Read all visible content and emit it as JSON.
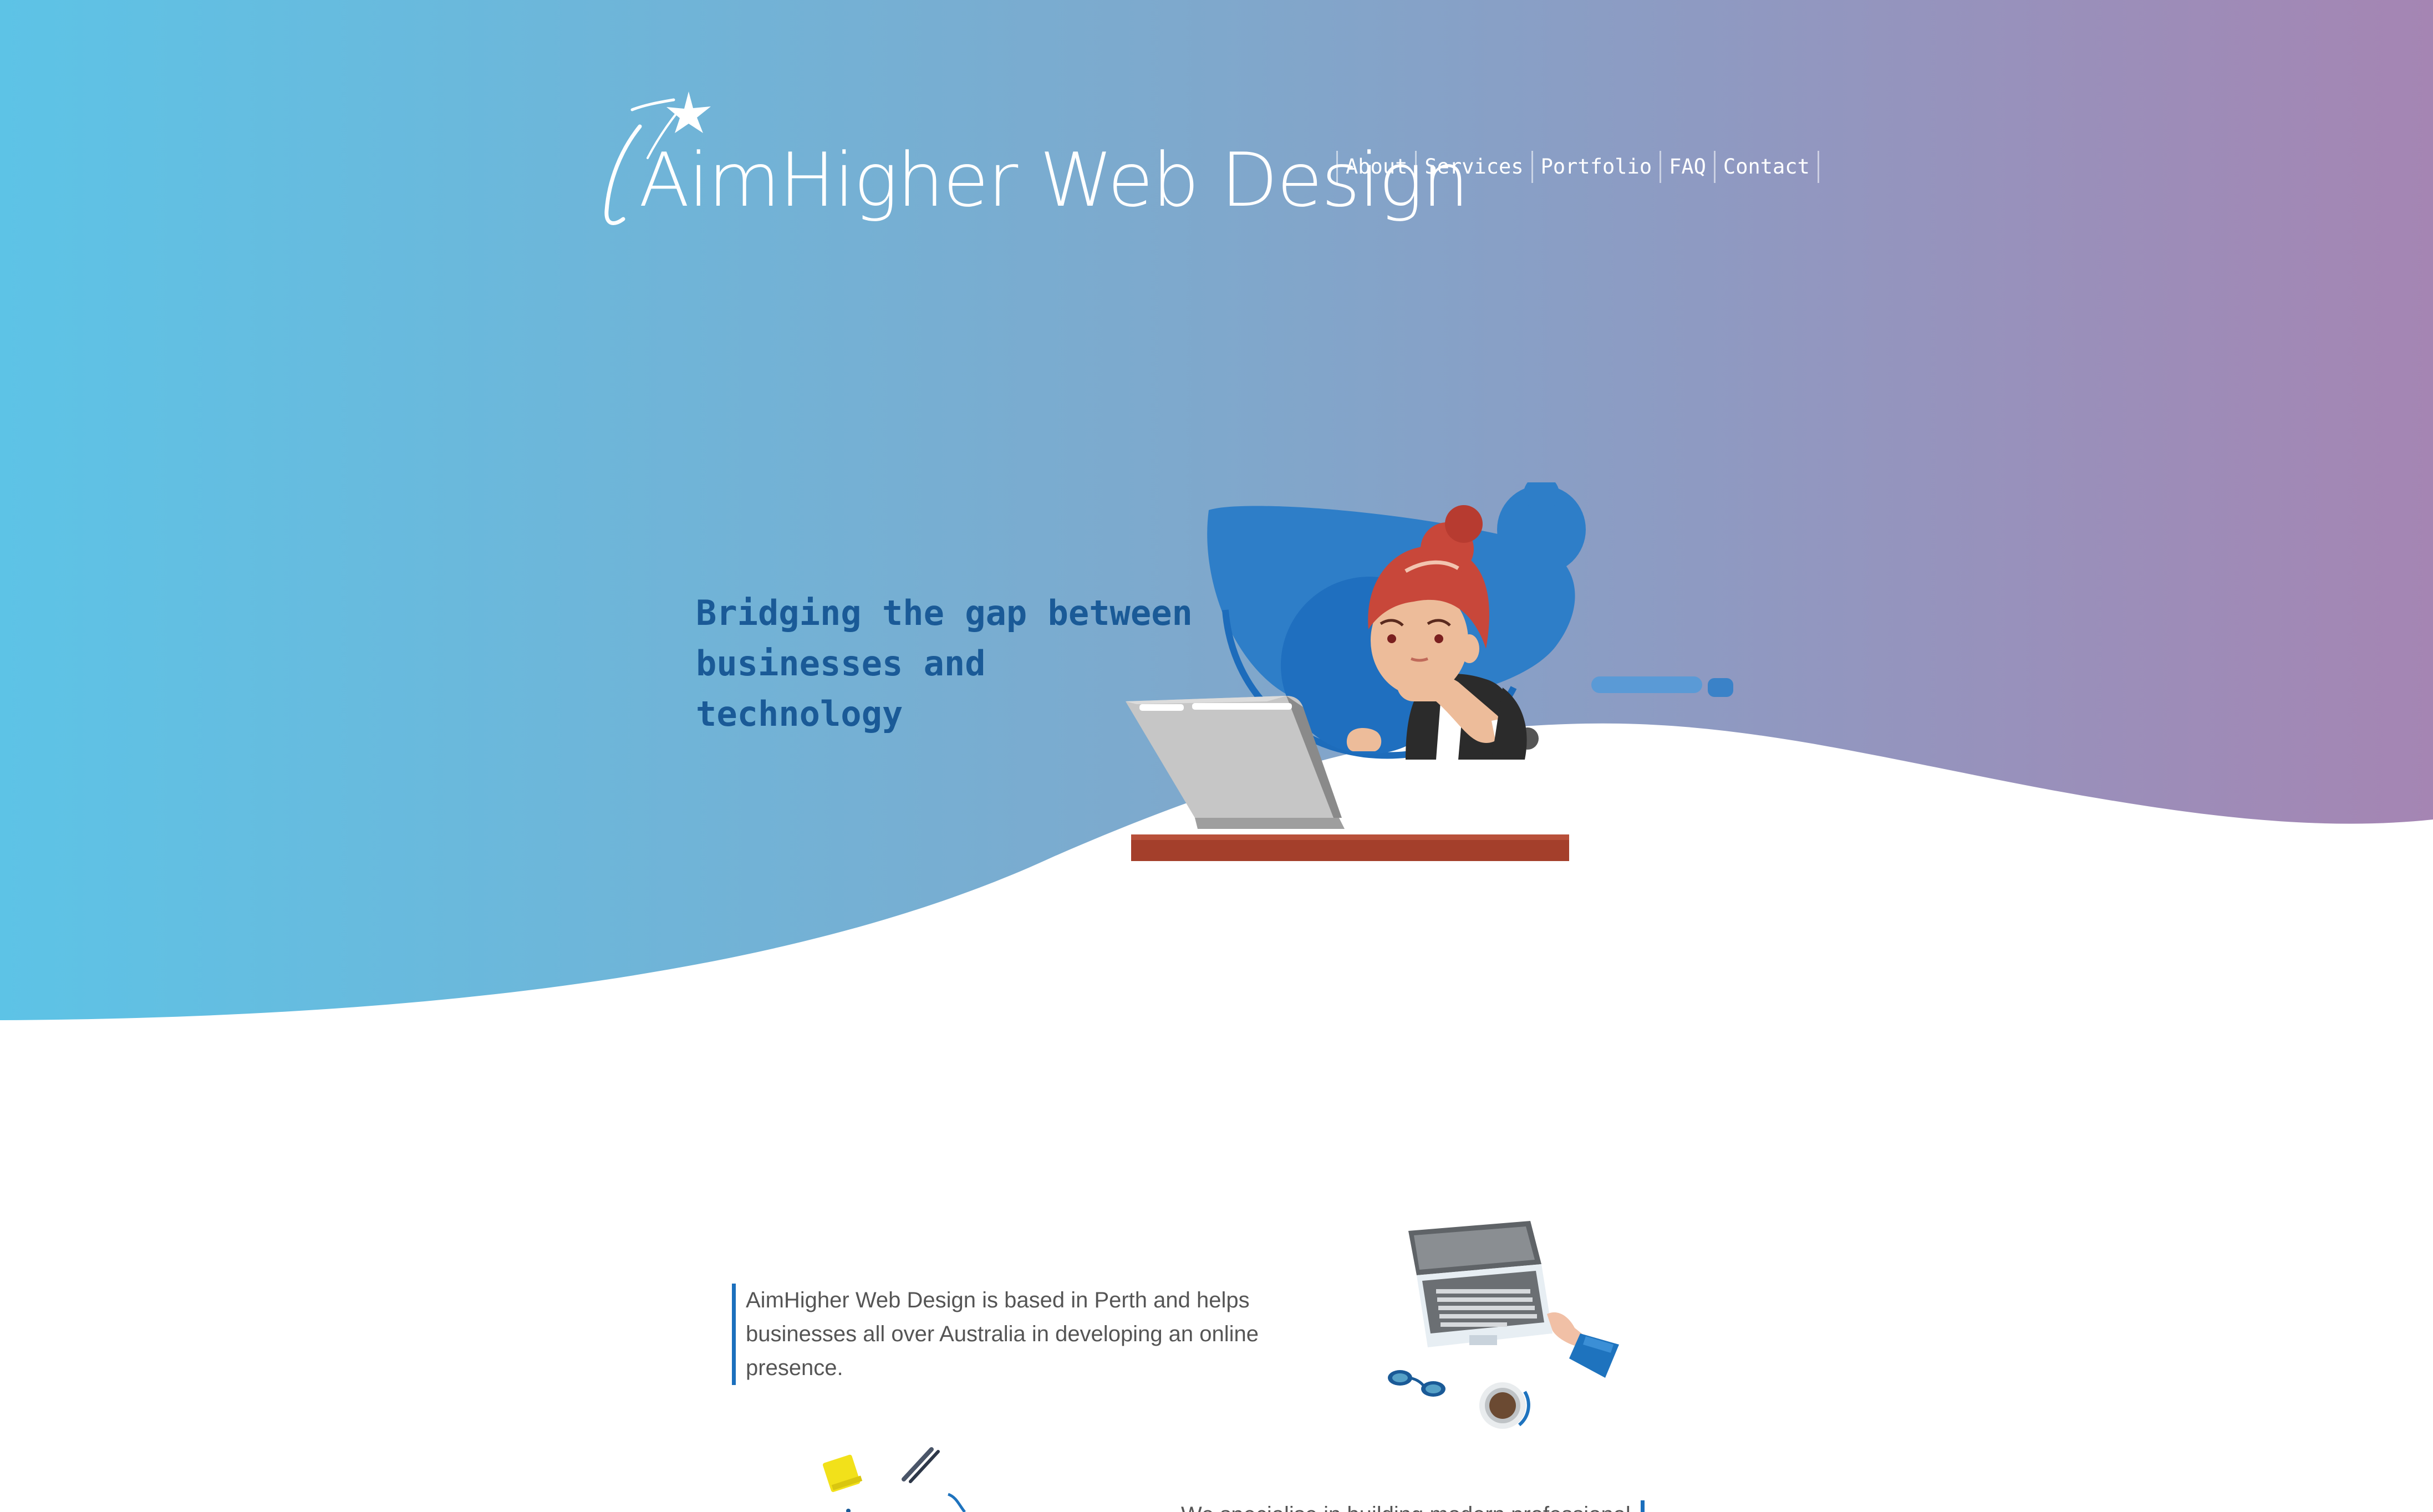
{
  "brand": {
    "name": "AimHigher Web Design"
  },
  "nav": {
    "items": [
      {
        "label": "About"
      },
      {
        "label": "Services"
      },
      {
        "label": "Portfolio"
      },
      {
        "label": "FAQ"
      },
      {
        "label": "Contact"
      }
    ]
  },
  "hero": {
    "tagline_lines": [
      "Bridging the gap between",
      "businesses and",
      "technology"
    ],
    "gradient_start": "#5dc3e6",
    "gradient_end": "#a585b3",
    "tagline_color": "#1a5a97",
    "illustration": "woman-at-laptop-illustration"
  },
  "about": {
    "text": "AimHigher Web Design is based in Perth and helps businesses all over Australia in developing an online presence.",
    "accent_color": "#1b6fbd",
    "illustration": "laptop-desk-topview-illustration"
  },
  "services_intro": {
    "text_partial": "We specialise in building modern professional"
  }
}
